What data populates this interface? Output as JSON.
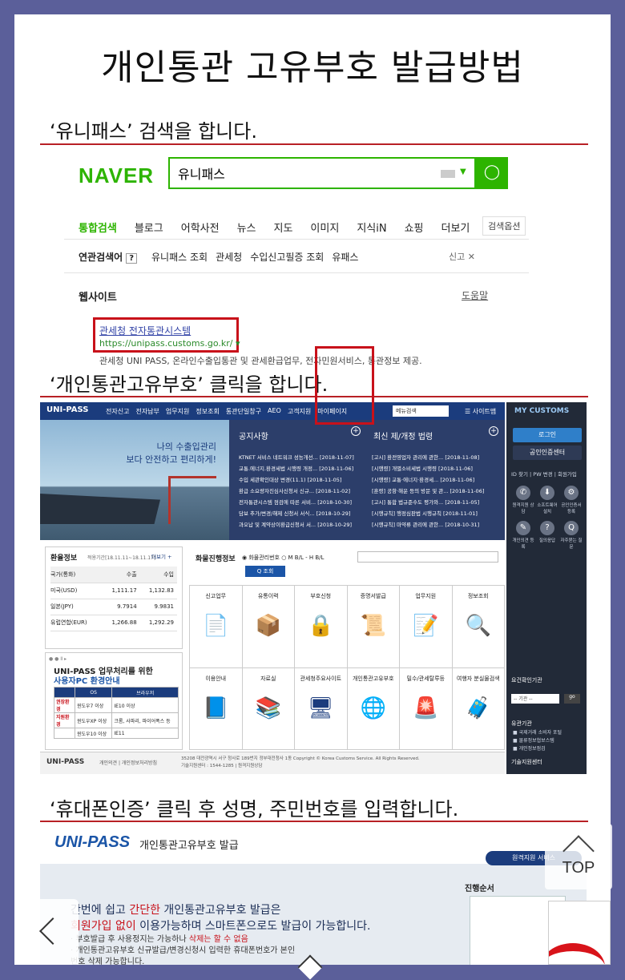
{
  "title": "개인통관 고유부호 발급방법",
  "steps": {
    "s1": "‘유니패스’ 검색을 합니다.",
    "s2": "‘개인통관고유부호’ 클릭을 합니다.",
    "s3": "‘휴대폰인증’ 클릭 후 성명, 주민번호를 입력합니다."
  },
  "colors": {
    "naver_green": "#2db400",
    "highlight_red": "#c8111a",
    "unipass_navy": "#1b3c7d",
    "background": "#5b5f9a"
  },
  "naver": {
    "logo": "NAVER",
    "query": "유니패스",
    "search_icon": "search-icon",
    "tabs": [
      "통합검색",
      "블로그",
      "어학사전",
      "뉴스",
      "지도",
      "이미지",
      "지식iN",
      "쇼핑",
      "더보기"
    ],
    "options": "검색옵션",
    "related_label": "연관검색어",
    "related": [
      "유니패스 조회",
      "관세청",
      "수입신고필증 조회",
      "유패스"
    ],
    "report": "신고",
    "website_label": "웹사이트",
    "help": "도움말",
    "result_title": "관세청 전자통관시스템",
    "result_url": "https://unipass.customs.go.kr/",
    "result_desc": "관세청 UNI PASS, 온라인수출입통관 및 관세환급업무, 전자민원서비스, 통관정보 제공."
  },
  "unipass": {
    "logo": "UNI-PASS",
    "menu": [
      "전자신고",
      "전자납부",
      "업무지원",
      "정보조회",
      "통관단일창구",
      "AEO",
      "고객지원",
      "마이페이지"
    ],
    "menu_search": "메뉴검색",
    "sitemap": "☰ 사이트맵",
    "banner_line1": "나의 수출입관리",
    "banner_line2": "보다 안전하고 편리하게!",
    "notice_title": "공지사항",
    "law_title": "최신 제/개정 법령",
    "notices": [
      {
        "t": "KTNET 서비스 네트워크 성능개선...",
        "d": "[2018-11-07]"
      },
      {
        "t": "교통.에너지.환경세법 시행령 개정...",
        "d": "[2018-11-06]"
      },
      {
        "t": "수입 세관확인대상 변경(11.1)",
        "d": "[2018-11-05]"
      },
      {
        "t": "환급 소요량자진심사신청서 신규...",
        "d": "[2018-11-02]"
      },
      {
        "t": "전자통관시스템 점검에 따른 서비...",
        "d": "[2018-10-30]"
      },
      {
        "t": "담보 추가/변경/해제 신청서 서식...",
        "d": "[2018-10-29]"
      },
      {
        "t": "과오납 및 계약상이환급신청서 서...",
        "d": "[2018-10-29]"
      }
    ],
    "laws": [
      {
        "t": "[고시] 환전영업자 관리에 관한...",
        "d": "[2018-11-08]"
      },
      {
        "t": "[시행령] 개별소비세법 시행령",
        "d": "[2018-11-06]"
      },
      {
        "t": "[시행령] 교통·에너지·환경세...",
        "d": "[2018-11-06]"
      },
      {
        "t": "[훈령] 공항·해운 등의 방문 및 관...",
        "d": "[2018-11-06]"
      },
      {
        "t": "[고시] 통합 법규준수도 평가와...",
        "d": "[2018-11-05]"
      },
      {
        "t": "[시행규칙] 행정심판법 시행규칙",
        "d": "[2018-11-01]"
      },
      {
        "t": "[시행규칙] 마약류 관리에 관한...",
        "d": "[2018-10-31]"
      }
    ],
    "exchange_title": "환율정보",
    "exchange_period": "적용기간[18.11.11~18.11.17]",
    "exchange_more": "더보기 +",
    "exchange_head": [
      "국가(통화)",
      "수출",
      "수입"
    ],
    "exchange_rows": [
      [
        "미국(USD)",
        "1,111.17",
        "1,132.83"
      ],
      [
        "일본(JPY)",
        "9.7914",
        "9.9831"
      ],
      [
        "유럽연합(EUR)",
        "1,266.88",
        "1,292.29"
      ]
    ],
    "pc_title1": "UNI-PASS 업무처리를 위한",
    "pc_title2": "사용자PC 환경안내",
    "pc_head": [
      "OS",
      "브라우저"
    ],
    "pc_rows": [
      [
        "권장환경",
        "윈도우7 이상",
        "IE10 이상"
      ],
      [
        "지원환경",
        "윈도우XP 이상",
        "크롬, 사파리, 파이어폭스 등"
      ],
      [
        "",
        "윈도우10 이상",
        "IE11"
      ]
    ],
    "cargo_label": "화물진행정보",
    "cargo_opt1": "화물관리번호",
    "cargo_opt2": "M B/L - H B/L",
    "cargo_btn": "Q 조회",
    "services": [
      {
        "label": "신고업무",
        "icon": "document-icon",
        "glyph": "📄"
      },
      {
        "label": "유통이력",
        "icon": "box-icon",
        "glyph": "📦"
      },
      {
        "label": "부호신청",
        "icon": "lock-icon",
        "glyph": "🔒"
      },
      {
        "label": "증명서발급",
        "icon": "certificate-icon",
        "glyph": "📜"
      },
      {
        "label": "업무지원",
        "icon": "pencil-doc-icon",
        "glyph": "📝"
      },
      {
        "label": "정보조회",
        "icon": "magnifier-icon",
        "glyph": "🔍"
      },
      {
        "label": "이용안내",
        "icon": "info-book-icon",
        "glyph": "📘"
      },
      {
        "label": "자료실",
        "icon": "books-icon",
        "glyph": "📚"
      },
      {
        "label": "관세청주요사이트",
        "icon": "browser-icon",
        "glyph": "🖥"
      },
      {
        "label": "개인통관고유부호",
        "icon": "globe-plane-icon",
        "glyph": "🌐"
      },
      {
        "label": "밀수/관세탈루등",
        "icon": "siren-icon",
        "glyph": "🚨"
      },
      {
        "label": "여행자 분실물검색",
        "icon": "luggage-icon",
        "glyph": "🧳"
      }
    ],
    "footer_logo": "UNI-PASS",
    "footer_links": "개인의견 | 개인정보처리방침",
    "footer_address": "35208 대전광역시 서구 청사로 189번지 정부대전청사 1동  Copyright © Korea Customs Service. All Rights Reserved.",
    "footer_tel": "기술지원센터 : 1544-1285 | 원격지원상담",
    "side_title": "MY CUSTOMS",
    "side_login": "로그인",
    "side_cert": "공인인증센터",
    "side_links": "ID 찾기 | PW 변경 | 회원가입",
    "side_icons": [
      {
        "label": "원격지원 상담",
        "glyph": "✆"
      },
      {
        "label": "소프트웨어 설치",
        "glyph": "⬇"
      },
      {
        "label": "공인인증서 등록",
        "glyph": "⚙"
      },
      {
        "label": "개인의견 등록",
        "glyph": "✎"
      },
      {
        "label": "질의응답",
        "glyph": "?"
      },
      {
        "label": "자주묻는 질문",
        "glyph": "Q"
      }
    ],
    "side_check": "요건확인기관",
    "side_select": "-- 기관 --",
    "side_go": "go",
    "side_orgs_title": "유관기관",
    "side_orgs": [
      "■ 국제거래 소비자 포털",
      "■ 물류정보협보스템",
      "■ 개인정보점검"
    ],
    "side_tech": "기술지원센터"
  },
  "mobile": {
    "logo": "UNI-PASS",
    "title": "개인통관고유부호 발급",
    "pill": "원격지원 서비스",
    "order": "진행순서",
    "line1a": "간번에 쉽고 ",
    "line1b": "간단한",
    "line1c": " 개인통관고유부호 발급은",
    "line2a": "회원가입 없이",
    "line2b": " 이용가능하며 스마트폰으로도 발급이 가능합니다.",
    "note1a": "부호발급 후 사용정지는 가능하나 ",
    "note1b": "삭제는 할 수 없음",
    "note2": "개인통관고유부호 신규발급/변경신청시 입력한 휴대폰번호가 본인",
    "note3": "번호 삭제 가능합니다."
  },
  "nav": {
    "top": "TOP"
  }
}
